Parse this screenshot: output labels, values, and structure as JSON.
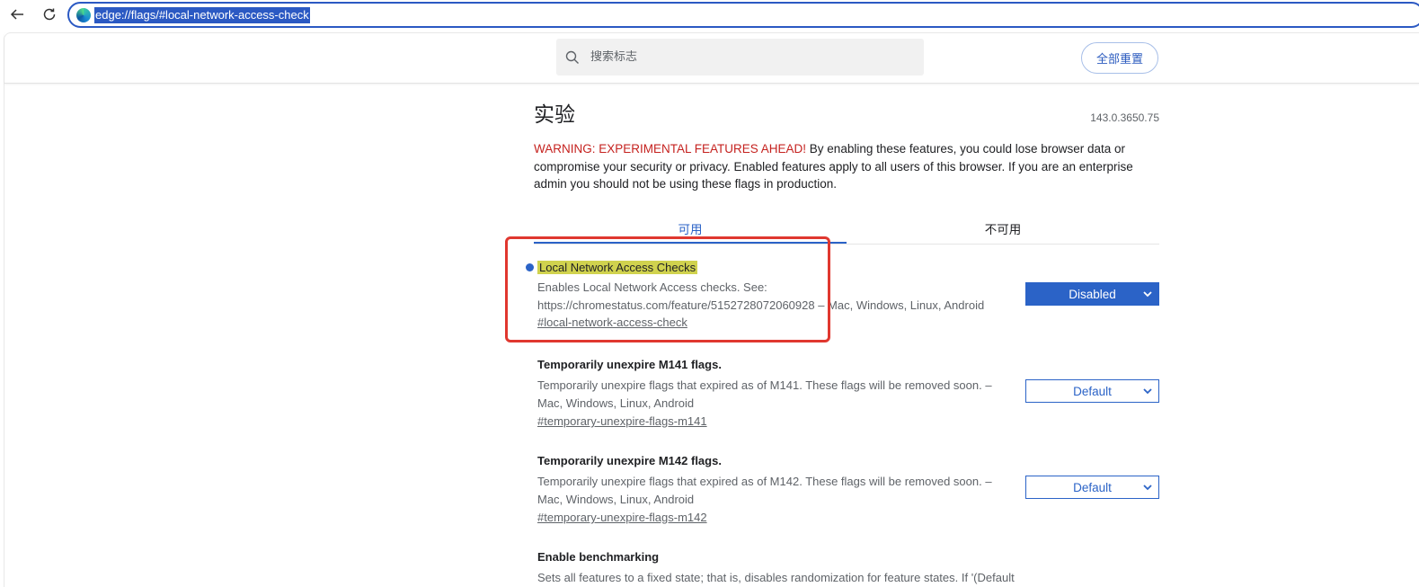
{
  "browser": {
    "url": "edge://flags/#local-network-access-check"
  },
  "header": {
    "search_placeholder": "搜索标志",
    "reset_label": "全部重置"
  },
  "main": {
    "title": "实验",
    "version": "143.0.3650.75",
    "warning_prefix": "WARNING: EXPERIMENTAL FEATURES AHEAD!",
    "warning_text": " By enabling these features, you could lose browser data or compromise your security or privacy. Enabled features apply to all users of this browser. If you are an enterprise admin you should not be using these flags in production.",
    "tabs": [
      {
        "label": "可用",
        "active": true
      },
      {
        "label": "不可用",
        "active": false
      }
    ]
  },
  "flags": [
    {
      "name": "Local Network Access Checks",
      "description": "Enables Local Network Access checks. See: https://chromestatus.com/feature/5152728072060928 – Mac, Windows, Linux, Android",
      "link": "#local-network-access-check",
      "value": "Disabled"
    },
    {
      "name": "Temporarily unexpire M141 flags.",
      "description": "Temporarily unexpire flags that expired as of M141. These flags will be removed soon. – Mac, Windows, Linux, Android",
      "link": "#temporary-unexpire-flags-m141",
      "value": "Default"
    },
    {
      "name": "Temporarily unexpire M142 flags.",
      "description": "Temporarily unexpire flags that expired as of M142. These flags will be removed soon. – Mac, Windows, Linux, Android",
      "link": "#temporary-unexpire-flags-m142",
      "value": "Default"
    },
    {
      "name": "Enable benchmarking",
      "description": "Sets all features to a fixed state; that is, disables randomization for feature states. If '(Default"
    }
  ],
  "colors": {
    "accent": "#2b63c7",
    "warning": "#c5221f",
    "highlight": "#d0d24e",
    "annotation": "#e0372f"
  }
}
